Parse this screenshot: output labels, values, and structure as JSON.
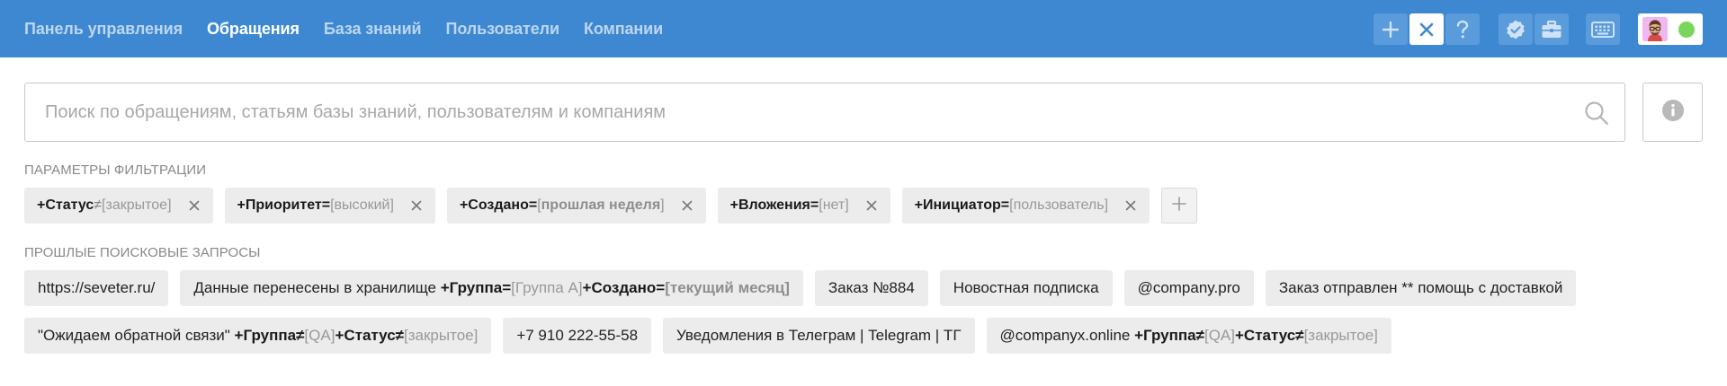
{
  "nav": {
    "items": [
      {
        "label": "Панель управления",
        "active": false
      },
      {
        "label": "Обращения",
        "active": true
      },
      {
        "label": "База знаний",
        "active": false
      },
      {
        "label": "Пользователи",
        "active": false
      },
      {
        "label": "Компании",
        "active": false
      }
    ]
  },
  "toolbar": {
    "icons": [
      "plus-icon",
      "close-icon",
      "help-icon",
      "verified-icon",
      "briefcase-icon",
      "keyboard-icon"
    ],
    "status_color": "#7ad65a",
    "accent": "#3d88d1"
  },
  "search": {
    "placeholder": "Поиск по обращениям, статьям базы знаний, пользователям и компаниям",
    "value": ""
  },
  "filters": {
    "title": "ПАРАМЕТРЫ ФИЛЬТРАЦИИ",
    "items": [
      {
        "key": "+Статус",
        "op": "≠",
        "open": "[",
        "value": "закрытое",
        "close": "]"
      },
      {
        "key": "+Приоритет",
        "op": "=",
        "open": "[",
        "value": "высокий",
        "close": "]"
      },
      {
        "key": "+Создано",
        "op": "=",
        "open": "[",
        "value": "прошлая неделя",
        "close": "]"
      },
      {
        "key": "+Вложения",
        "op": "=",
        "open": "[",
        "value": "нет",
        "close": "]"
      },
      {
        "key": "+Инициатор",
        "op": "=",
        "open": "[",
        "value": "пользователь",
        "close": "]"
      }
    ]
  },
  "history": {
    "title": "ПРОШЛЫЕ ПОИСКОВЫЕ ЗАПРОСЫ",
    "row1": [
      {
        "text": "https://seveter.ru/"
      },
      {
        "text": "Данные перенесены в хранилище ",
        "k1": "+Группа",
        "op1": "=",
        "v1": "[Группа А]",
        "k2": "+Создано",
        "op2": "=",
        "v2": "[текущий месяц]"
      },
      {
        "text": "Заказ №884"
      },
      {
        "text": "Новостная подписка"
      },
      {
        "text": "@company.pro"
      },
      {
        "text": "Заказ отправлен ** помощь с доставкой"
      }
    ],
    "row2": [
      {
        "text": "\"Ожидаем обратной связи\" ",
        "k1": "+Группа",
        "op1": "≠",
        "v1": "[QA]",
        "k2": "+Статус",
        "op2": "≠",
        "v2": "[закрытое]"
      },
      {
        "text": "+7 910 222-55-58"
      },
      {
        "text": "Уведомления в Телеграм | Telegram | ТГ"
      },
      {
        "text": "@companyx.online ",
        "k1": "+Группа",
        "op1": "≠",
        "v1": "[QA]",
        "k2": "+Статус",
        "op2": "≠",
        "v2": "[закрытое]"
      }
    ]
  }
}
